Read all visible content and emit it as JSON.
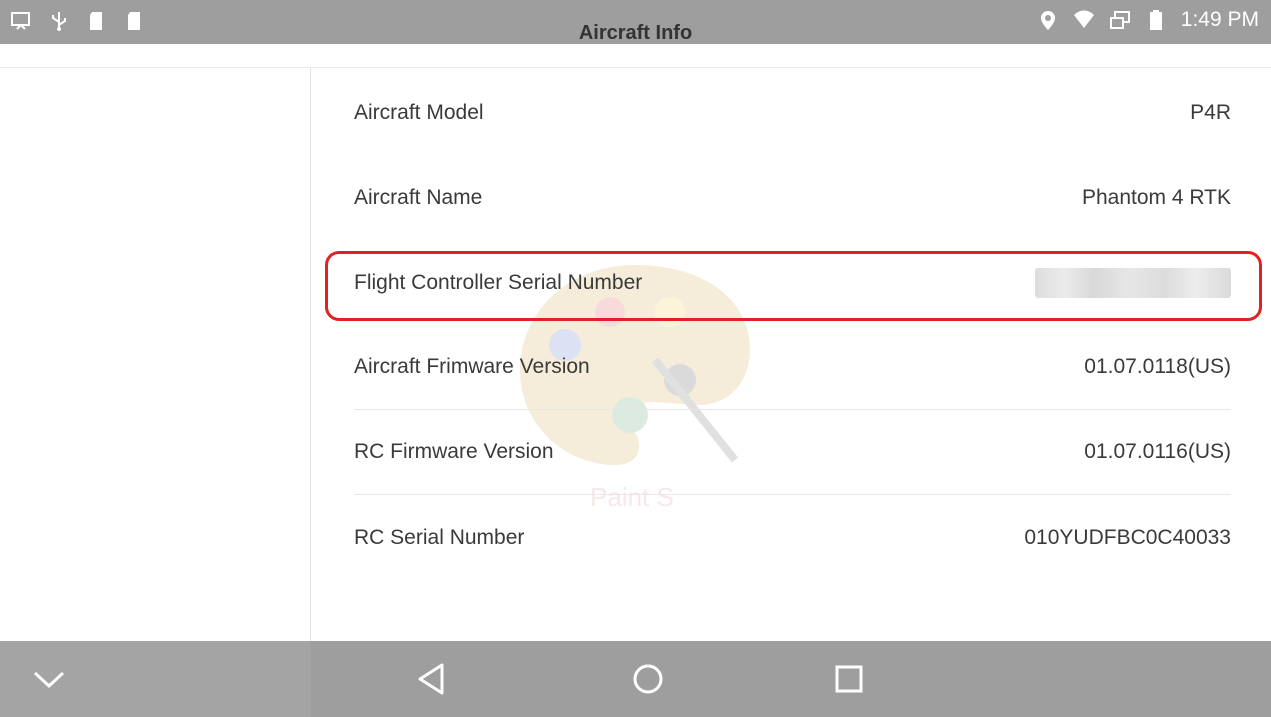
{
  "status_bar": {
    "left_icons": [
      "screenshot-icon",
      "usb-icon",
      "sd-card-icon",
      "sd-card-icon"
    ],
    "right_icons": [
      "location-icon",
      "wifi-icon",
      "screen-mirror-icon",
      "battery-icon"
    ],
    "time": "1:49 PM"
  },
  "header": {
    "title": "Aircraft Info"
  },
  "info": {
    "rows": [
      {
        "label": "Aircraft Model",
        "value": "P4R"
      },
      {
        "label": "Aircraft Name",
        "value": "Phantom 4 RTK"
      },
      {
        "label": "Flight Controller Serial Number",
        "value": ""
      },
      {
        "label": "Aircraft Frimware Version",
        "value": "01.07.0118(US)"
      },
      {
        "label": "RC Firmware Version",
        "value": "01.07.0116(US)"
      },
      {
        "label": "RC Serial Number",
        "value": "010YUDFBC0C40033"
      }
    ]
  },
  "watermark": {
    "text": "Paint S"
  },
  "nav_bar": {
    "icons": [
      "chevron-down-icon",
      "back-icon",
      "home-icon",
      "recents-icon"
    ]
  },
  "colors": {
    "status_bar": "#9e9e9e",
    "highlight": "#e02222",
    "text": "#3a3a3a"
  }
}
